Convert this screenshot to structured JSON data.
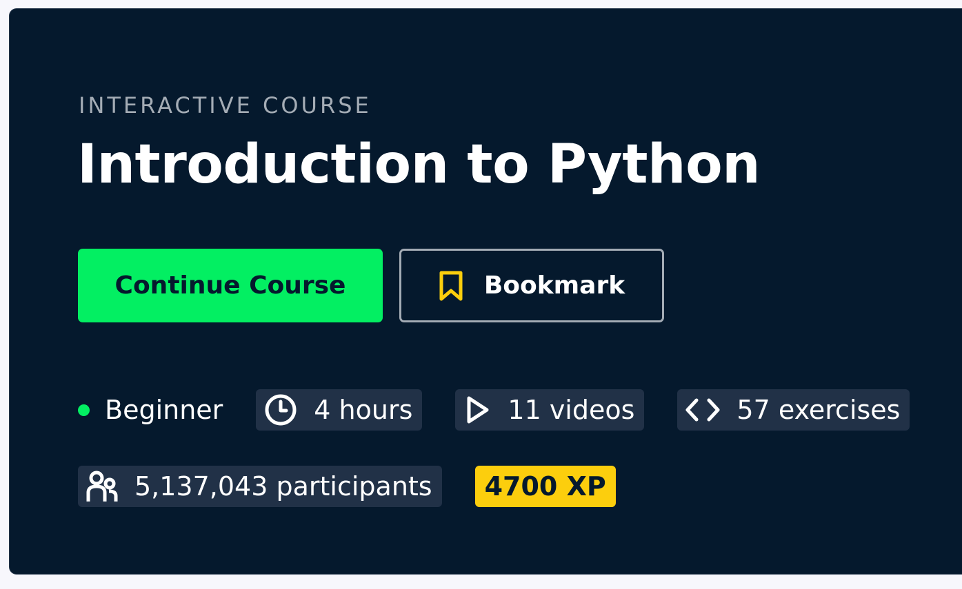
{
  "course": {
    "eyebrow": "INTERACTIVE COURSE",
    "title": "Introduction to Python"
  },
  "actions": {
    "primary_label": "Continue Course",
    "bookmark_label": "Bookmark",
    "bookmark_icon": "bookmark-icon"
  },
  "meta": {
    "level": "Beginner",
    "duration": "4 hours",
    "videos": "11 videos",
    "exercises": "57 exercises",
    "participants": "5,137,043 participants",
    "xp": "4700 XP"
  },
  "icons": {
    "duration": "clock-icon",
    "videos": "play-icon",
    "exercises": "code-icon",
    "participants": "people-icon"
  },
  "colors": {
    "background": "#05192d",
    "primary": "#03ef62",
    "bookmark_icon": "#fcce0d",
    "xp_badge": "#fcce0d",
    "chip": "#213147",
    "level_dot": "#03ef62"
  }
}
